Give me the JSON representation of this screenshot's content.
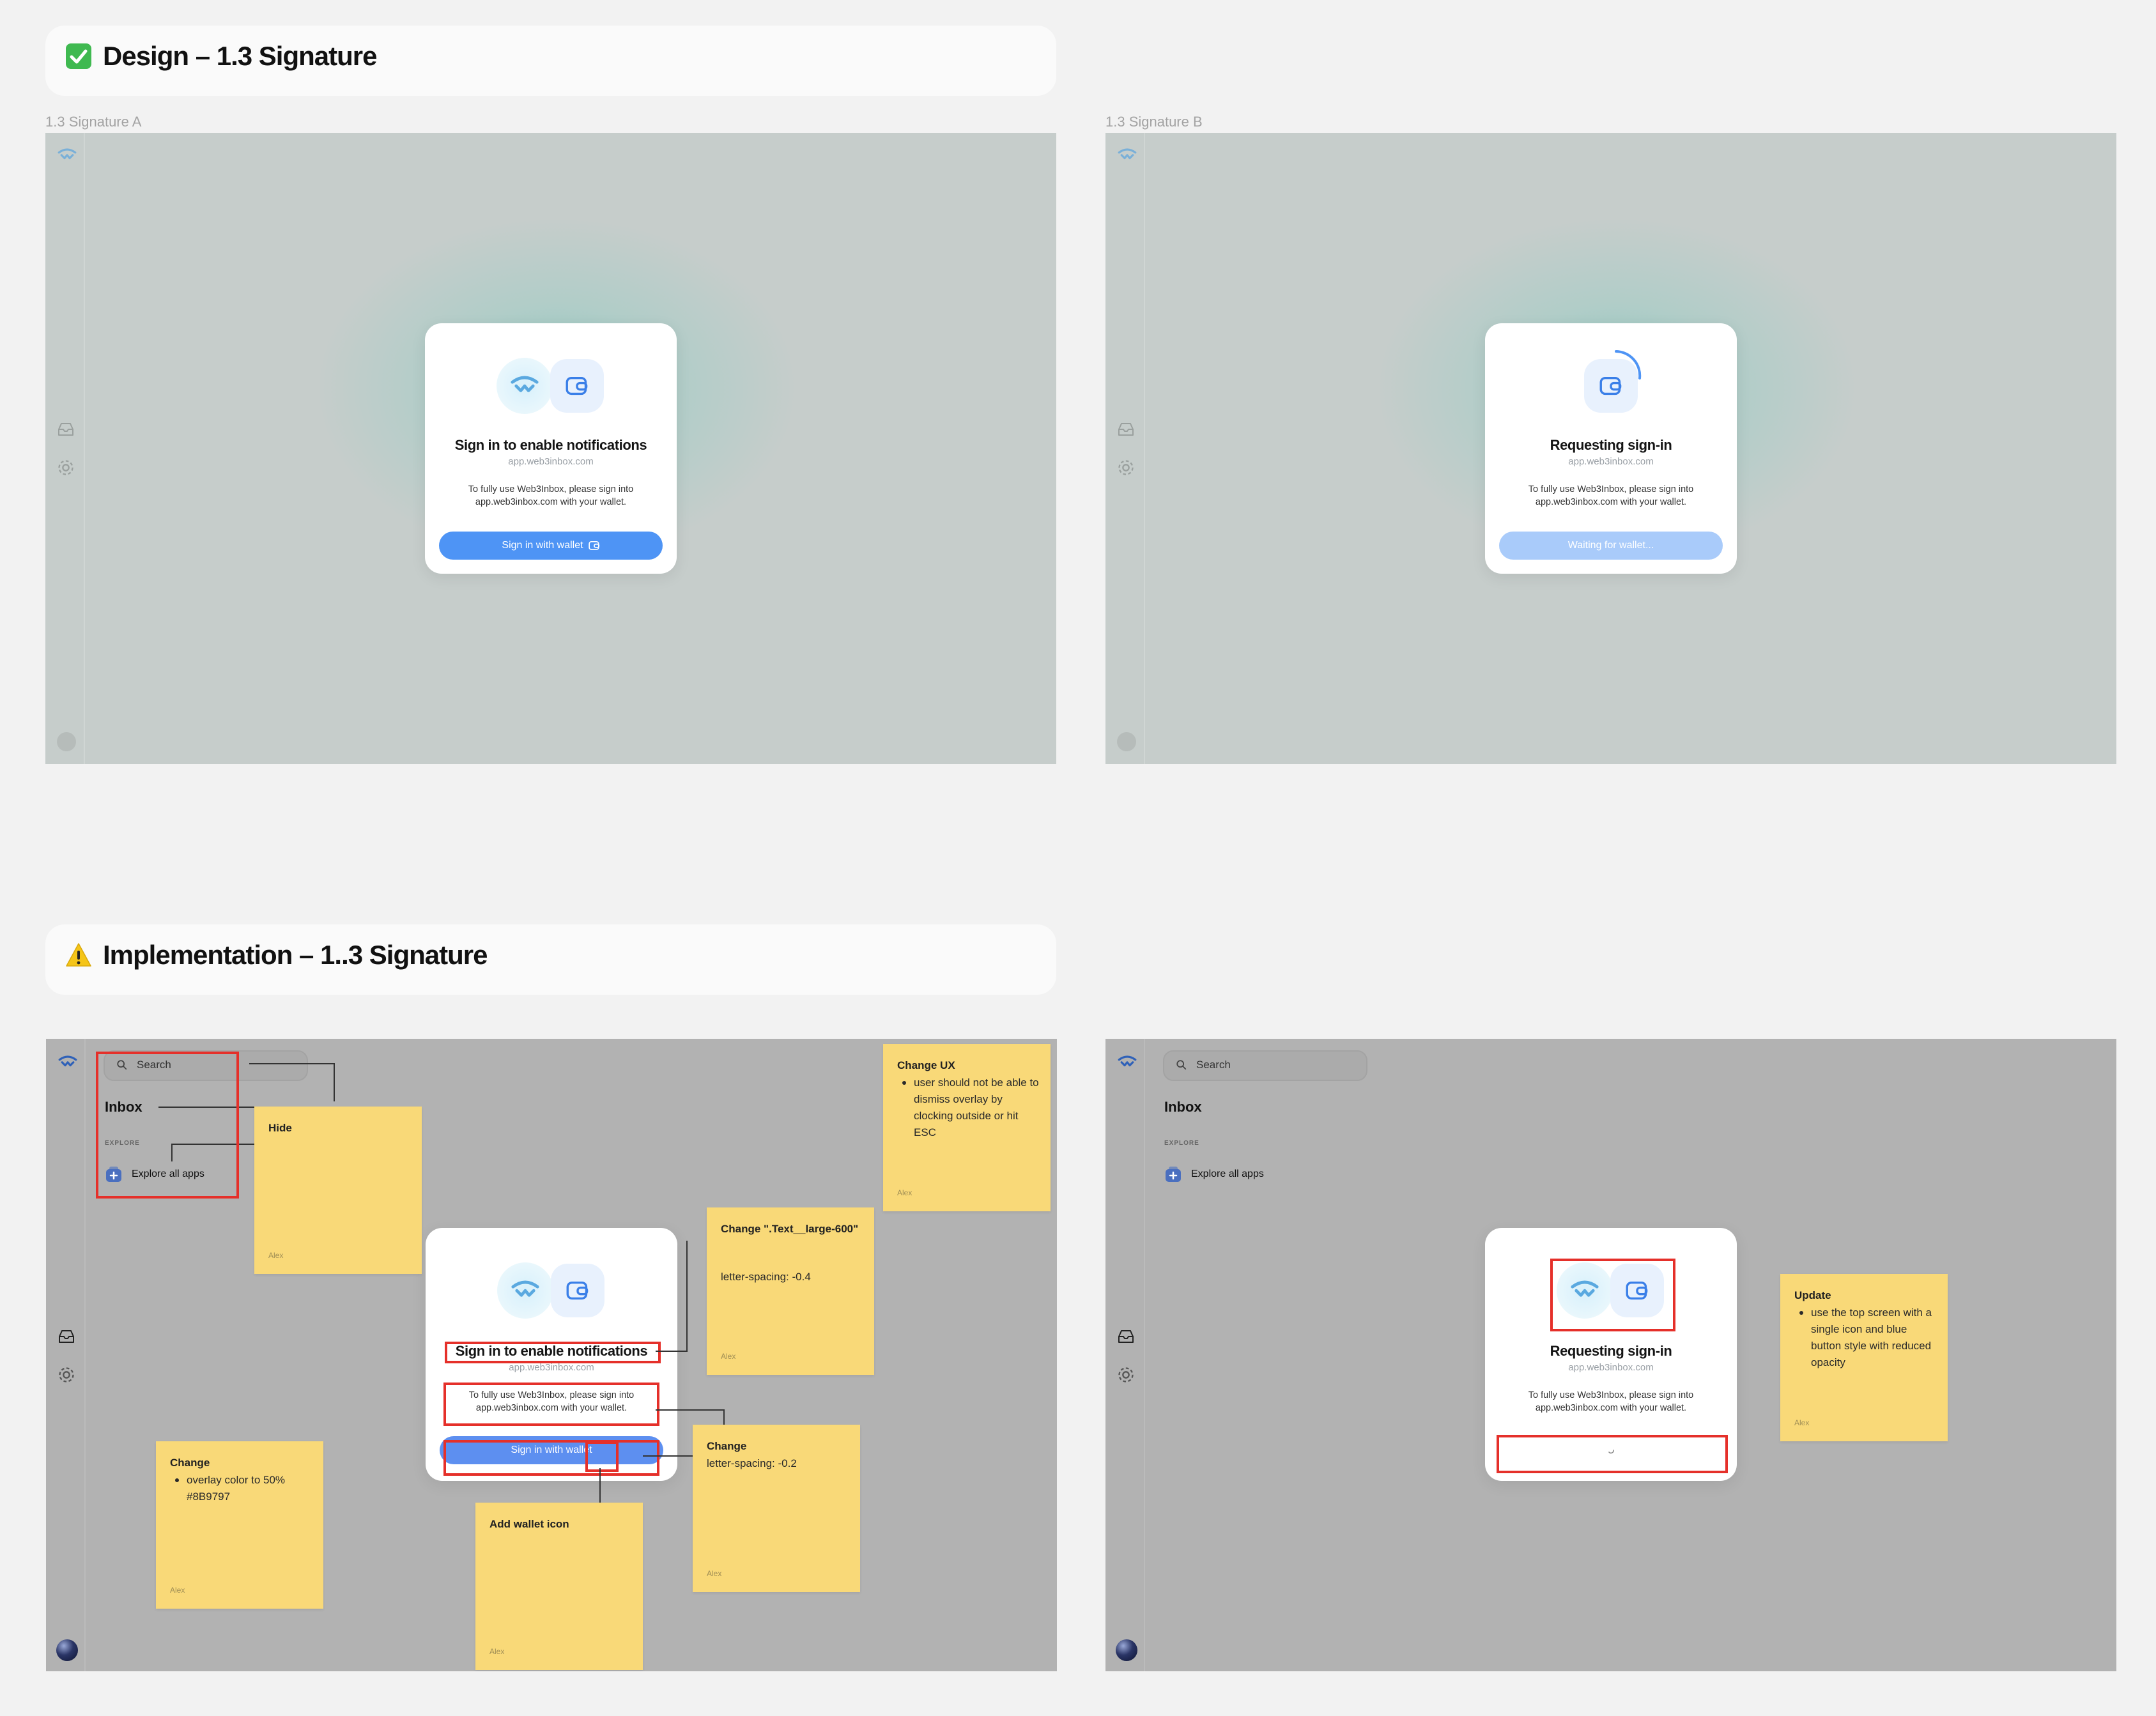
{
  "sections": {
    "design": {
      "emoji": "✅",
      "title": "Design – 1.3 Signature"
    },
    "implementation": {
      "emoji": "⚠️",
      "title": "Implementation – 1..3 Signature"
    }
  },
  "frames": {
    "design_a": {
      "label": "1.3 Signature A",
      "modal": {
        "title": "Sign in to enable notifications",
        "url": "app.web3inbox.com",
        "description": "To fully use Web3Inbox, please sign into app.web3inbox.com with your wallet.",
        "button_label": "Sign in with wallet"
      }
    },
    "design_b": {
      "label": "1.3 Signature B",
      "modal": {
        "title": "Requesting sign-in",
        "url": "app.web3inbox.com",
        "description": "To fully use Web3Inbox, please sign into app.web3inbox.com with your wallet.",
        "button_label": "Waiting for wallet..."
      }
    },
    "impl_a": {
      "search_placeholder": "Search",
      "inbox_title": "Inbox",
      "explore_label": "EXPLORE",
      "explore_item": "Explore all apps",
      "modal": {
        "title": "Sign in to enable notifications",
        "url": "app.web3inbox.com",
        "description": "To fully use Web3Inbox, please sign into app.web3inbox.com with your wallet.",
        "button_label": "Sign in with wallet"
      }
    },
    "impl_b": {
      "search_placeholder": "Search",
      "inbox_title": "Inbox",
      "explore_label": "EXPLORE",
      "explore_item": "Explore all apps",
      "modal": {
        "title": "Requesting sign-in",
        "url": "app.web3inbox.com",
        "description": "To fully use Web3Inbox, please sign into app.web3inbox.com with your wallet."
      }
    }
  },
  "stickies": {
    "hide": {
      "title": "Hide",
      "author": "Alex"
    },
    "change_ux": {
      "title": "Change UX",
      "bullet": "user should not be able to dismiss overlay by clocking outside or hit ESC",
      "author": "Alex"
    },
    "change_text": {
      "title": "Change \".Text__large-600\"",
      "body": "letter-spacing: -0.4",
      "author": "Alex"
    },
    "change_overlay": {
      "title": "Change",
      "bullet": "overlay color to 50% #8B9797",
      "author": "Alex"
    },
    "add_wallet_icon": {
      "title": "Add wallet icon",
      "author": "Alex"
    },
    "change_spacing": {
      "title": "Change",
      "body": "letter-spacing: -0.2",
      "author": "Alex"
    },
    "update": {
      "title": "Update",
      "bullet": "use the top screen with a single icon and blue button style with reduced opacity",
      "author": "Alex"
    }
  },
  "colors": {
    "primary_blue": "#4e94f5",
    "disabled_blue": "#a9cbfa",
    "sticky_yellow": "#f9d978",
    "annotation_red": "#e5302a",
    "overlay_design": "#c6cdcb",
    "overlay_impl": "#b2b2b2"
  }
}
